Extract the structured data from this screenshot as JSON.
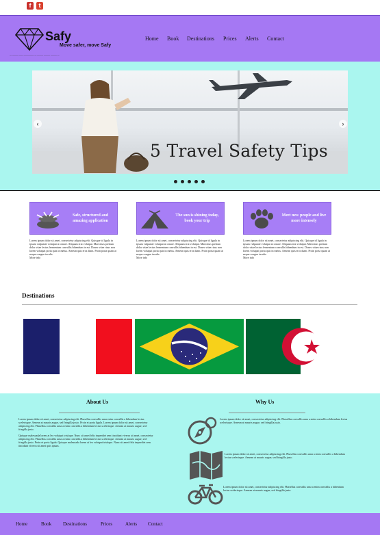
{
  "social": {
    "facebook_glyph": "f",
    "twitter_glyph": "t"
  },
  "brand": {
    "name": "Safy",
    "tagline": "Move safer, move Safy",
    "small_print": "— ——— —— ————— — ——— ——— ——— —"
  },
  "nav": [
    "Home",
    "Book",
    "Destinations",
    "Prices",
    "Alerts",
    "Contact"
  ],
  "hero": {
    "caption": "5 Travel Safety Tips",
    "prev_glyph": "‹",
    "next_glyph": "›",
    "dot_count": 5
  },
  "features": [
    {
      "title": "Safe, structured and amazing application",
      "text": "Lorem ipsum dolor sit amet, consectetur adipiscing elit. Quisque id ligula in ipsum vulputate volutpat at ornare. Aliquam erat volutpat. Maecenas pretium dolor vitae lectus fermentum convallis bibendum in est. Donec vitae risus non lorem volutpat porta quis in metus. Aenean quis eros diam. Proin porta quam at neque congue iaculis.",
      "more": "More info",
      "icon": "animal-print-icon"
    },
    {
      "title": "The sun is shining today, book your trip",
      "text": "Lorem ipsum dolor sit amet, consectetur adipiscing elit. Quisque id ligula in ipsum vulputate volutpat at ornare. Aliquam erat volutpat. Maecenas pretium dolor vitae lectus fermentum convallis bibendum in est. Donec vitae risus non lorem volutpat porta quis in metus. Aenean quis eros diam. Proin porta quam at neque congue iaculis.",
      "more": "More info",
      "icon": "tent-icon"
    },
    {
      "title": "Meet new people and live more intensely",
      "text": "Lorem ipsum dolor sit amet, consectetur adipiscing elit. Quisque id ligula in ipsum vulputate volutpat at ornare. Aliquam erat volutpat. Maecenas pretium dolor vitae lectus fermentum convallis bibendum in est. Donec vitae risus non lorem volutpat porta quis in metus. Aenean quis eros diam. Proin porta quam at neque congue iaculis.",
      "more": "More info",
      "icon": "paw-print-icon"
    }
  ],
  "destinations": {
    "title": "Destinations",
    "flags": [
      "france-flag",
      "brazil-flag",
      "algeria-flag"
    ]
  },
  "about": {
    "title": "About Us",
    "p1": "Lorem ipsum dolor sit amet, consectetur adipiscing elit. Phasellus convallis urna enim convallis a bibendum lectus scelerisque. Aenean at mauris augue, sed fringilla justo. Proin et porta ligula. Lorem ipsum dolor sit amet, consectetur adipiscing elit. Phasellus convallis urna a enim convallis a bibendum lectus scelerisque. Aenean at mauris augue, sed fringilla justo.",
    "p2": "Quisque malesuada lorem at leo volutpat tristique. Nunc sit amet felis imperdiet sem tincidunt viverra sit amet, consectetur adipiscing elit. Phasellus convallis urna a enim convallis a bibendum lectus scelerisque. Aenean at mauris augue, sed fringilla justo. Proin et porta ligula. Quisque malesuada lorem at leo volutpat tristique. Nunc sit amet felis imperdiet sem tincidunt viverra sit amet quis ipsum."
  },
  "why": {
    "title": "Why Us",
    "items": [
      {
        "icon": "compass-icon",
        "text": "Lorem ipsum dolor sit amet, consectetur adipiscing elit. Phasellus convallis urna a enim convallis a bibendum lectus scelerisque. Aenean at mauris augue, sed fringilla justo."
      },
      {
        "icon": "map-icon",
        "text": "Lorem ipsum dolor sit amet, consectetur adipiscing elit. Phasellus convallis urna a enim convallis a bibendum lectus scelerisque. Aenean at mauris augue, sed fringilla justo."
      },
      {
        "icon": "bicycle-icon",
        "text": "Lorem ipsum dolor sit amet, consectetur adipiscing elit. Phasellus convallis urna a enim convallis a bibendum lectus scelerisque. Aenean at mauris augue, sed fringilla justo."
      }
    ]
  },
  "footer": {
    "nav": [
      "Home",
      "Book",
      "Destinations",
      "Prices",
      "Alerts",
      "Contact"
    ]
  },
  "colors": {
    "purple": "#a578f3",
    "aqua": "#aaf6ef",
    "feature_purple": "#a77ef6"
  }
}
